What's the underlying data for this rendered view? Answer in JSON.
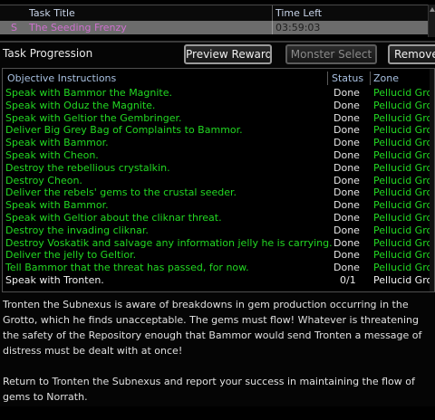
{
  "task_list": {
    "columns": {
      "title": "Task Title",
      "time_left": "Time Left"
    },
    "rows": [
      {
        "type": "S",
        "title": "The Seeding Frenzy",
        "time_left": "03:59:03"
      }
    ]
  },
  "progress": {
    "label": "Task Progression",
    "buttons": {
      "preview": "Preview Reward",
      "monster": "Monster Select",
      "remove": "Remove"
    }
  },
  "objectives": {
    "columns": {
      "instructions": "Objective Instructions",
      "status": "Status",
      "zone": "Zone"
    },
    "rows": [
      {
        "instr": "Speak with Bammor the Magnite.",
        "status": "Done",
        "zone": "Pellucid Grotto"
      },
      {
        "instr": "Speak with Oduz the Magnite.",
        "status": "Done",
        "zone": "Pellucid Grotto"
      },
      {
        "instr": "Speak with Geltior the Gembringer.",
        "status": "Done",
        "zone": "Pellucid Grotto"
      },
      {
        "instr": "Deliver Big Grey Bag of Complaints to Bammor.",
        "status": "Done",
        "zone": "Pellucid Grotto"
      },
      {
        "instr": "Speak with Bammor.",
        "status": "Done",
        "zone": "Pellucid Grotto"
      },
      {
        "instr": "Speak with Cheon.",
        "status": "Done",
        "zone": "Pellucid Grotto"
      },
      {
        "instr": "Destroy the rebellious crystalkin.",
        "status": "Done",
        "zone": "Pellucid Grotto"
      },
      {
        "instr": "Destroy Cheon.",
        "status": "Done",
        "zone": "Pellucid Grotto"
      },
      {
        "instr": "Deliver the rebels' gems to the crustal seeder.",
        "status": "Done",
        "zone": "Pellucid Grotto"
      },
      {
        "instr": "Speak with Bammor.",
        "status": "Done",
        "zone": "Pellucid Grotto"
      },
      {
        "instr": "Speak with Geltior about the cliknar threat.",
        "status": "Done",
        "zone": "Pellucid Grotto"
      },
      {
        "instr": "Destroy the invading cliknar.",
        "status": "Done",
        "zone": "Pellucid Grotto"
      },
      {
        "instr": "Destroy Voskatik and salvage any information jelly he is carrying.",
        "status": "Done",
        "zone": "Pellucid Grotto"
      },
      {
        "instr": "Deliver the jelly to Geltior.",
        "status": "Done",
        "zone": "Pellucid Grotto"
      },
      {
        "instr": "Tell Bammor that the threat has passed, for now.",
        "status": "Done",
        "zone": "Pellucid Grotto"
      },
      {
        "instr": "Speak with Tronten.",
        "status": "0/1",
        "zone": "Pellucid Grotto",
        "current": true
      }
    ]
  },
  "description": {
    "paragraphs": [
      "Tronten the Subnexus is aware of breakdowns in gem production occurring in the Grotto, which he finds unacceptable. The gems must flow! Whatever is threatening the safety of the Repository enough that Bammor would send Tronten a message of distress must be dealt with at once!",
      "Return to Tronten the Subnexus and report your success in maintaining the flow of gems to Norrath."
    ]
  },
  "colors": {
    "done_text": "#22d822",
    "selected_row": "#6c6c6c",
    "task_title": "#d070d0",
    "header_text": "#a8c0e0"
  }
}
